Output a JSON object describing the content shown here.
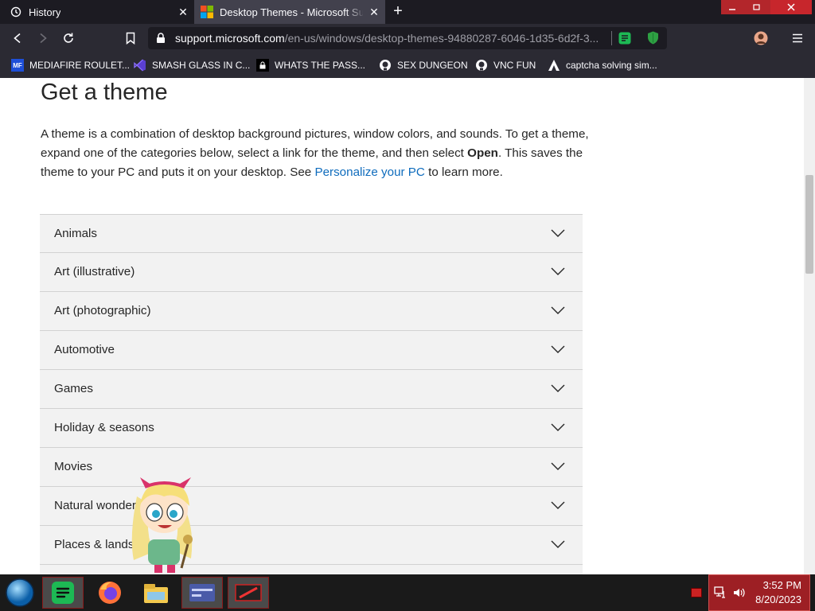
{
  "browser": {
    "tabs": [
      {
        "label": "History",
        "icon": "history-icon"
      },
      {
        "label": "Desktop Themes - Microsoft Support",
        "icon": "microsoft-logo-icon",
        "active": true
      }
    ],
    "url_domain": "support.microsoft.com",
    "url_path": "/en-us/windows/desktop-themes-94880287-6046-1d35-6d2f-3..."
  },
  "bookmarks": [
    {
      "label": "MEDIAFIRE ROULET...",
      "icon": "mediafire-icon",
      "icon_text": "MF"
    },
    {
      "label": "SMASH GLASS IN C...",
      "icon": "visual-studio-icon"
    },
    {
      "label": "WHATS THE PASS...",
      "icon": "lock-icon"
    },
    {
      "label": "SEX DUNGEON",
      "icon": "github-icon"
    },
    {
      "label": "VNC FUN",
      "icon": "github-icon"
    },
    {
      "label": "captcha solving sim...",
      "icon": "arch-icon"
    }
  ],
  "page": {
    "heading": "Get a theme",
    "intro": {
      "part1": "A theme is a combination of desktop background pictures, window colors, and sounds. To get a theme, expand one of the categories below, select a link for the theme, and then select ",
      "bold": "Open",
      "part2": ". This saves the theme to your PC and puts it on your desktop. See ",
      "link": "Personalize your PC",
      "part3": " to learn more."
    },
    "categories": [
      "Animals",
      "Art (illustrative)",
      "Art (photographic)",
      "Automotive",
      "Games",
      "Holiday & seasons",
      "Movies",
      "Natural wonders",
      "Places & landscapes"
    ]
  },
  "taskbar": {
    "apps": [
      "start-orb",
      "spotify-icon",
      "firefox-icon",
      "file-explorer-icon",
      "card-app-icon",
      "media-app-icon"
    ],
    "time": "3:52 PM",
    "date": "8/20/2023"
  },
  "colors": {
    "accent_link": "#0f6cbd",
    "accordion_bg": "#f2f2f2",
    "tray_red": "#9d1f24"
  }
}
